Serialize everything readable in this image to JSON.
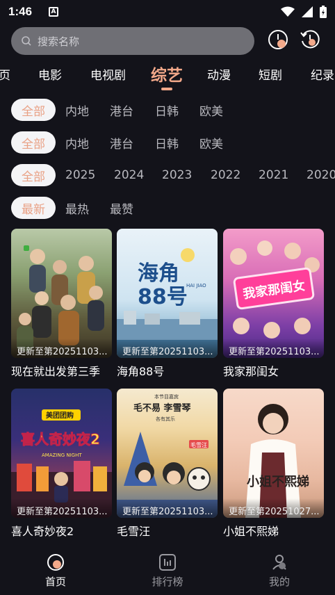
{
  "status_bar": {
    "time": "1:46",
    "notification_icon": "A"
  },
  "search": {
    "placeholder": "搜索名称"
  },
  "top_icons": [
    "history-clock-icon",
    "refresh-clock-icon"
  ],
  "categories": [
    {
      "label": "页",
      "active": false
    },
    {
      "label": "电影",
      "active": false
    },
    {
      "label": "电视剧",
      "active": false
    },
    {
      "label": "综艺",
      "active": true
    },
    {
      "label": "动漫",
      "active": false
    },
    {
      "label": "短剧",
      "active": false
    },
    {
      "label": "纪录",
      "active": false
    }
  ],
  "filters": {
    "region1": [
      "全部",
      "内地",
      "港台",
      "日韩",
      "欧美"
    ],
    "region2": [
      "全部",
      "内地",
      "港台",
      "日韩",
      "欧美"
    ],
    "years": [
      "全部",
      "2025",
      "2024",
      "2023",
      "2022",
      "2021",
      "2020"
    ],
    "sort": [
      "最新",
      "最热",
      "最赞"
    ]
  },
  "shows": [
    {
      "title": "现在就出发第三季",
      "update": "更新至第20251103..."
    },
    {
      "title": "海角88号",
      "update": "更新至第20251103..."
    },
    {
      "title": "我家那闺女",
      "update": "更新至第20251103..."
    },
    {
      "title": "喜人奇妙夜2",
      "update": "更新至第20251103..."
    },
    {
      "title": "毛雪汪",
      "update": "更新至第20251103..."
    },
    {
      "title": "小姐不熙娣",
      "update": "更新至第20251027..."
    }
  ],
  "poster_text": {
    "p2_main": "海角",
    "p2_num": "88号",
    "p2_sub": "HAI JIAO",
    "p3_main": "我家那闺女",
    "p4_brand": "美团团购",
    "p4_main": "喜人奇妙夜2",
    "p4_sub": "AMAZING NIGHT",
    "p5_top": "本节目嘉宾",
    "p5_main": "毛不易  李雪琴",
    "p5_sub": "各有其乐",
    "p5_sign": "毛雪汪",
    "p6_main": "小姐不熙娣"
  },
  "bottom_nav": [
    {
      "label": "首页",
      "icon": "home-icon",
      "active": true
    },
    {
      "label": "排行榜",
      "icon": "ranking-icon",
      "active": false
    },
    {
      "label": "我的",
      "icon": "profile-icon",
      "active": false
    }
  ],
  "colors": {
    "accent": "#f3a98a",
    "background": "#13131a",
    "search_bg": "#6f6f75"
  }
}
